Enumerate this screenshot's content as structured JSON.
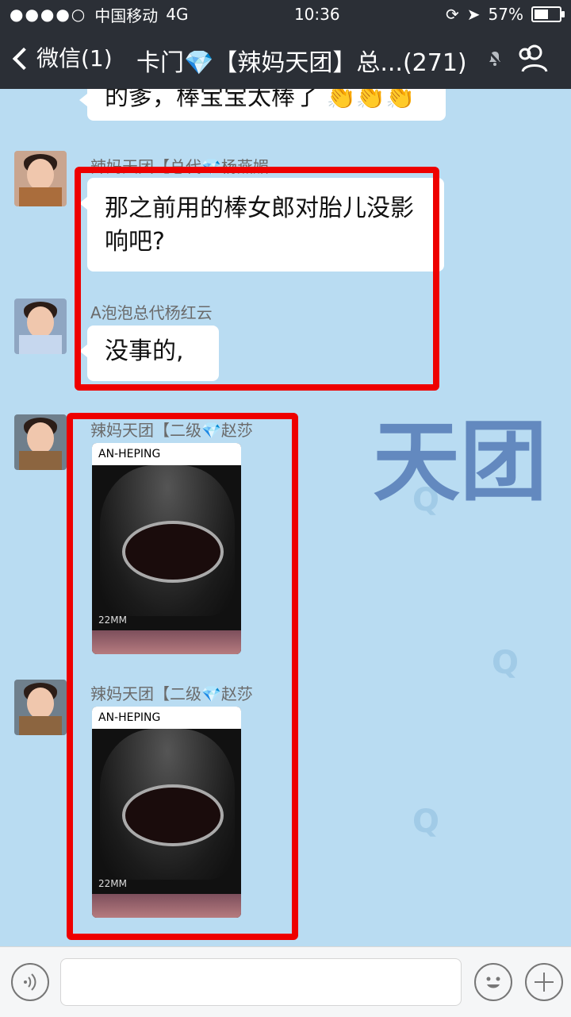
{
  "status": {
    "signal": "●●●●○",
    "carrier": "中国移动",
    "network": "4G",
    "time": "10:36",
    "battery_percent": "57%",
    "battery_level": 0.57
  },
  "nav": {
    "back_label": "微信(1)",
    "title": "卡门💎【辣妈天团】总...(271)"
  },
  "chat": {
    "partial_message": "的爹，棒宝宝太棒了 👏👏👏",
    "messages": [
      {
        "sender": "辣妈天团【总代💎杨燕媚",
        "text": "那之前用的棒女郎对胎儿没影响吧?"
      },
      {
        "sender": "A泡泡总代杨红云",
        "text": "没事的,"
      },
      {
        "sender": "辣妈天团【二级💎赵莎",
        "image_header": "AN-HEPING",
        "image_label": "22MM"
      },
      {
        "sender": "辣妈天团【二级💎赵莎",
        "image_header": "AN-HEPING",
        "image_label": "22MM"
      }
    ]
  },
  "icons": {
    "back": "chevron-left-icon",
    "mute": "mute-bell-icon",
    "group": "group-icon",
    "voice": "voice-icon",
    "emoji": "emoji-icon",
    "plus": "plus-icon"
  }
}
